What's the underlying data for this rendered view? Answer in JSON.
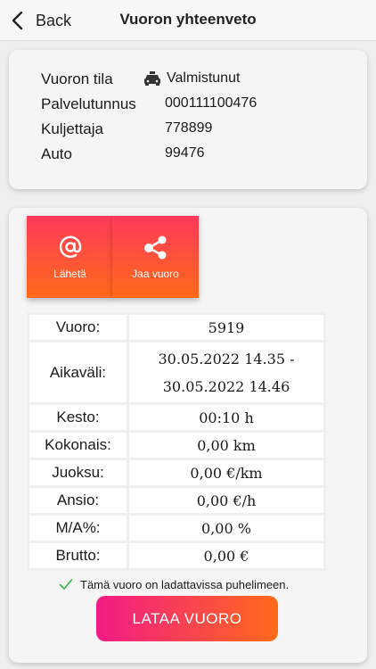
{
  "nav": {
    "back_label": "Back",
    "title": "Vuoron yhteenveto"
  },
  "info": {
    "rows": [
      {
        "key": "Vuoron tila",
        "value": "Valmistunut",
        "icon": "taxi-icon"
      },
      {
        "key": "Palvelutunnus",
        "value": "000111100476"
      },
      {
        "key": "Kuljettaja",
        "value": "778899"
      },
      {
        "key": "Auto",
        "value": "99476"
      }
    ]
  },
  "actions": {
    "send_label": "Lähetä",
    "share_label": "Jaa vuoro"
  },
  "summary": {
    "rows": [
      {
        "key": "Vuoro:",
        "value": "5919"
      },
      {
        "key": "Aikaväli:",
        "value_line1": "30.05.2022 14.35 -",
        "value_line2": "30.05.2022 14.46"
      },
      {
        "key": "Kesto:",
        "value": "00:10 h"
      },
      {
        "key": "Kokonais:",
        "value": "0,00 km"
      },
      {
        "key": "Juoksu:",
        "value": "0,00 €/km"
      },
      {
        "key": "Ansio:",
        "value": "0,00 €/h"
      },
      {
        "key": "M/A%:",
        "value": "0,00 %"
      },
      {
        "key": "Brutto:",
        "value": "0,00 €"
      }
    ]
  },
  "note": "Tämä vuoro on ladattavissa puhelimeen.",
  "load_button": "LATAA VUORO",
  "colors": {
    "accent_start": "#ff3a5a",
    "accent_end": "#ff6a1a",
    "check": "#3cb043"
  }
}
